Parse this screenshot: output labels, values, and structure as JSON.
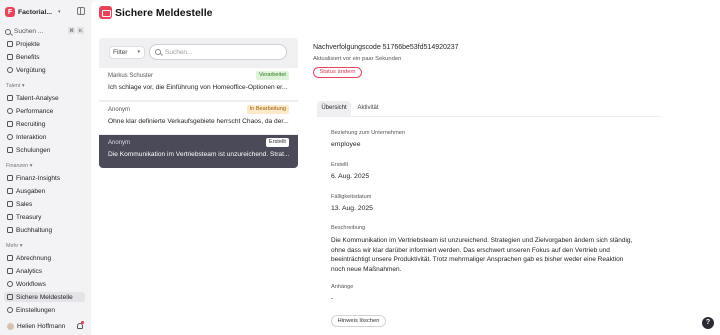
{
  "sidebar": {
    "brand": "Factorial...",
    "search_label": "Suchen ...",
    "shortcut_keys": [
      "⌘",
      "K"
    ],
    "items_top": [
      {
        "label": "Projekte",
        "icon": "folder-icon"
      },
      {
        "label": "Benefits",
        "icon": "gift-icon"
      },
      {
        "label": "Vergütung",
        "icon": "coins-icon"
      }
    ],
    "section_talent": "Talent",
    "items_talent": [
      {
        "label": "Talent-Analyse",
        "icon": "chart-icon"
      },
      {
        "label": "Performance",
        "icon": "target-icon"
      },
      {
        "label": "Recruiting",
        "icon": "briefcase-icon"
      },
      {
        "label": "Interaktion",
        "icon": "chat-icon"
      },
      {
        "label": "Schulungen",
        "icon": "graduation-icon"
      }
    ],
    "section_finanzen": "Finanzen",
    "items_finanzen": [
      {
        "label": "Finanz-Insights",
        "icon": "insights-icon"
      },
      {
        "label": "Ausgaben",
        "icon": "receipt-icon"
      },
      {
        "label": "Sales",
        "icon": "tag-icon"
      },
      {
        "label": "Treasury",
        "icon": "bank-icon"
      },
      {
        "label": "Buchhaltung",
        "icon": "ledger-icon"
      }
    ],
    "section_mehr": "Mehr",
    "items_mehr": [
      {
        "label": "Abrechnung",
        "icon": "calculator-icon"
      },
      {
        "label": "Analytics",
        "icon": "bar-chart-icon"
      },
      {
        "label": "Workflows",
        "icon": "workflow-icon"
      },
      {
        "label": "Sichere Meldestelle",
        "icon": "shield-message-icon"
      },
      {
        "label": "Einstellungen",
        "icon": "gear-icon"
      }
    ],
    "user": {
      "name": "Helien Hoffmann"
    }
  },
  "header": {
    "title": "Sichere Meldestelle"
  },
  "list": {
    "filter_label": "Filter",
    "search_placeholder": "Suchen...",
    "reports": [
      {
        "author": "Markus Schuster",
        "status": "Verarbeitet",
        "text": "Ich schlage vor, die Einführung von Homeoffice-Optionen er...",
        "status_bg": "#dff3d8",
        "status_fg": "#2f7a25"
      },
      {
        "author": "Anonym",
        "status": "In Bearbeitung",
        "text": "Ohne klar definierte Verkaufsgebiete herrscht Chaos, da der...",
        "status_bg": "#fbe9c9",
        "status_fg": "#9a5b05"
      },
      {
        "author": "Anonym",
        "status": "Erstellt",
        "text": "Die Kommunikation im Vertriebsteam ist unzureichend. Strat...",
        "status_bg": "#ffffff",
        "status_fg": "#333333"
      }
    ]
  },
  "detail": {
    "tracking_code": "Nachverfolgungscode 51766be53fd514920237",
    "updated": "Aktualisiert vor ein paar Sekunden",
    "status_button": "Status ändern",
    "tabs": [
      "Übersicht",
      "Aktivität"
    ],
    "fields": {
      "relation_label": "Beziehung zum Unternehmen",
      "relation_value": "employee",
      "created_label": "Erstellt",
      "created_value": "6. Aug. 2025",
      "due_label": "Fälligkeitsdatum",
      "due_value": "13. Aug. 2025",
      "description_label": "Beschreibung",
      "description_value": "Die Kommunikation im Vertriebsteam ist unzureichend. Strategien und Zielvorgaben ändern sich ständig, ohne dass wir klar darüber informiert werden. Das erschwert unseren Fokus auf den Vertrieb und beeinträchtigt unsere Produktivität. Trotz mehrmaliger Ansprachen gab es bisher weder eine Reaktion noch neue Maßnahmen.",
      "attachments_label": "Anhänge",
      "attachments_value": "-"
    },
    "delete_hint": "Hinweis löschen",
    "help": "?"
  },
  "colors": {
    "brand": "#e6445a",
    "selected_row": "#4a4a58"
  }
}
